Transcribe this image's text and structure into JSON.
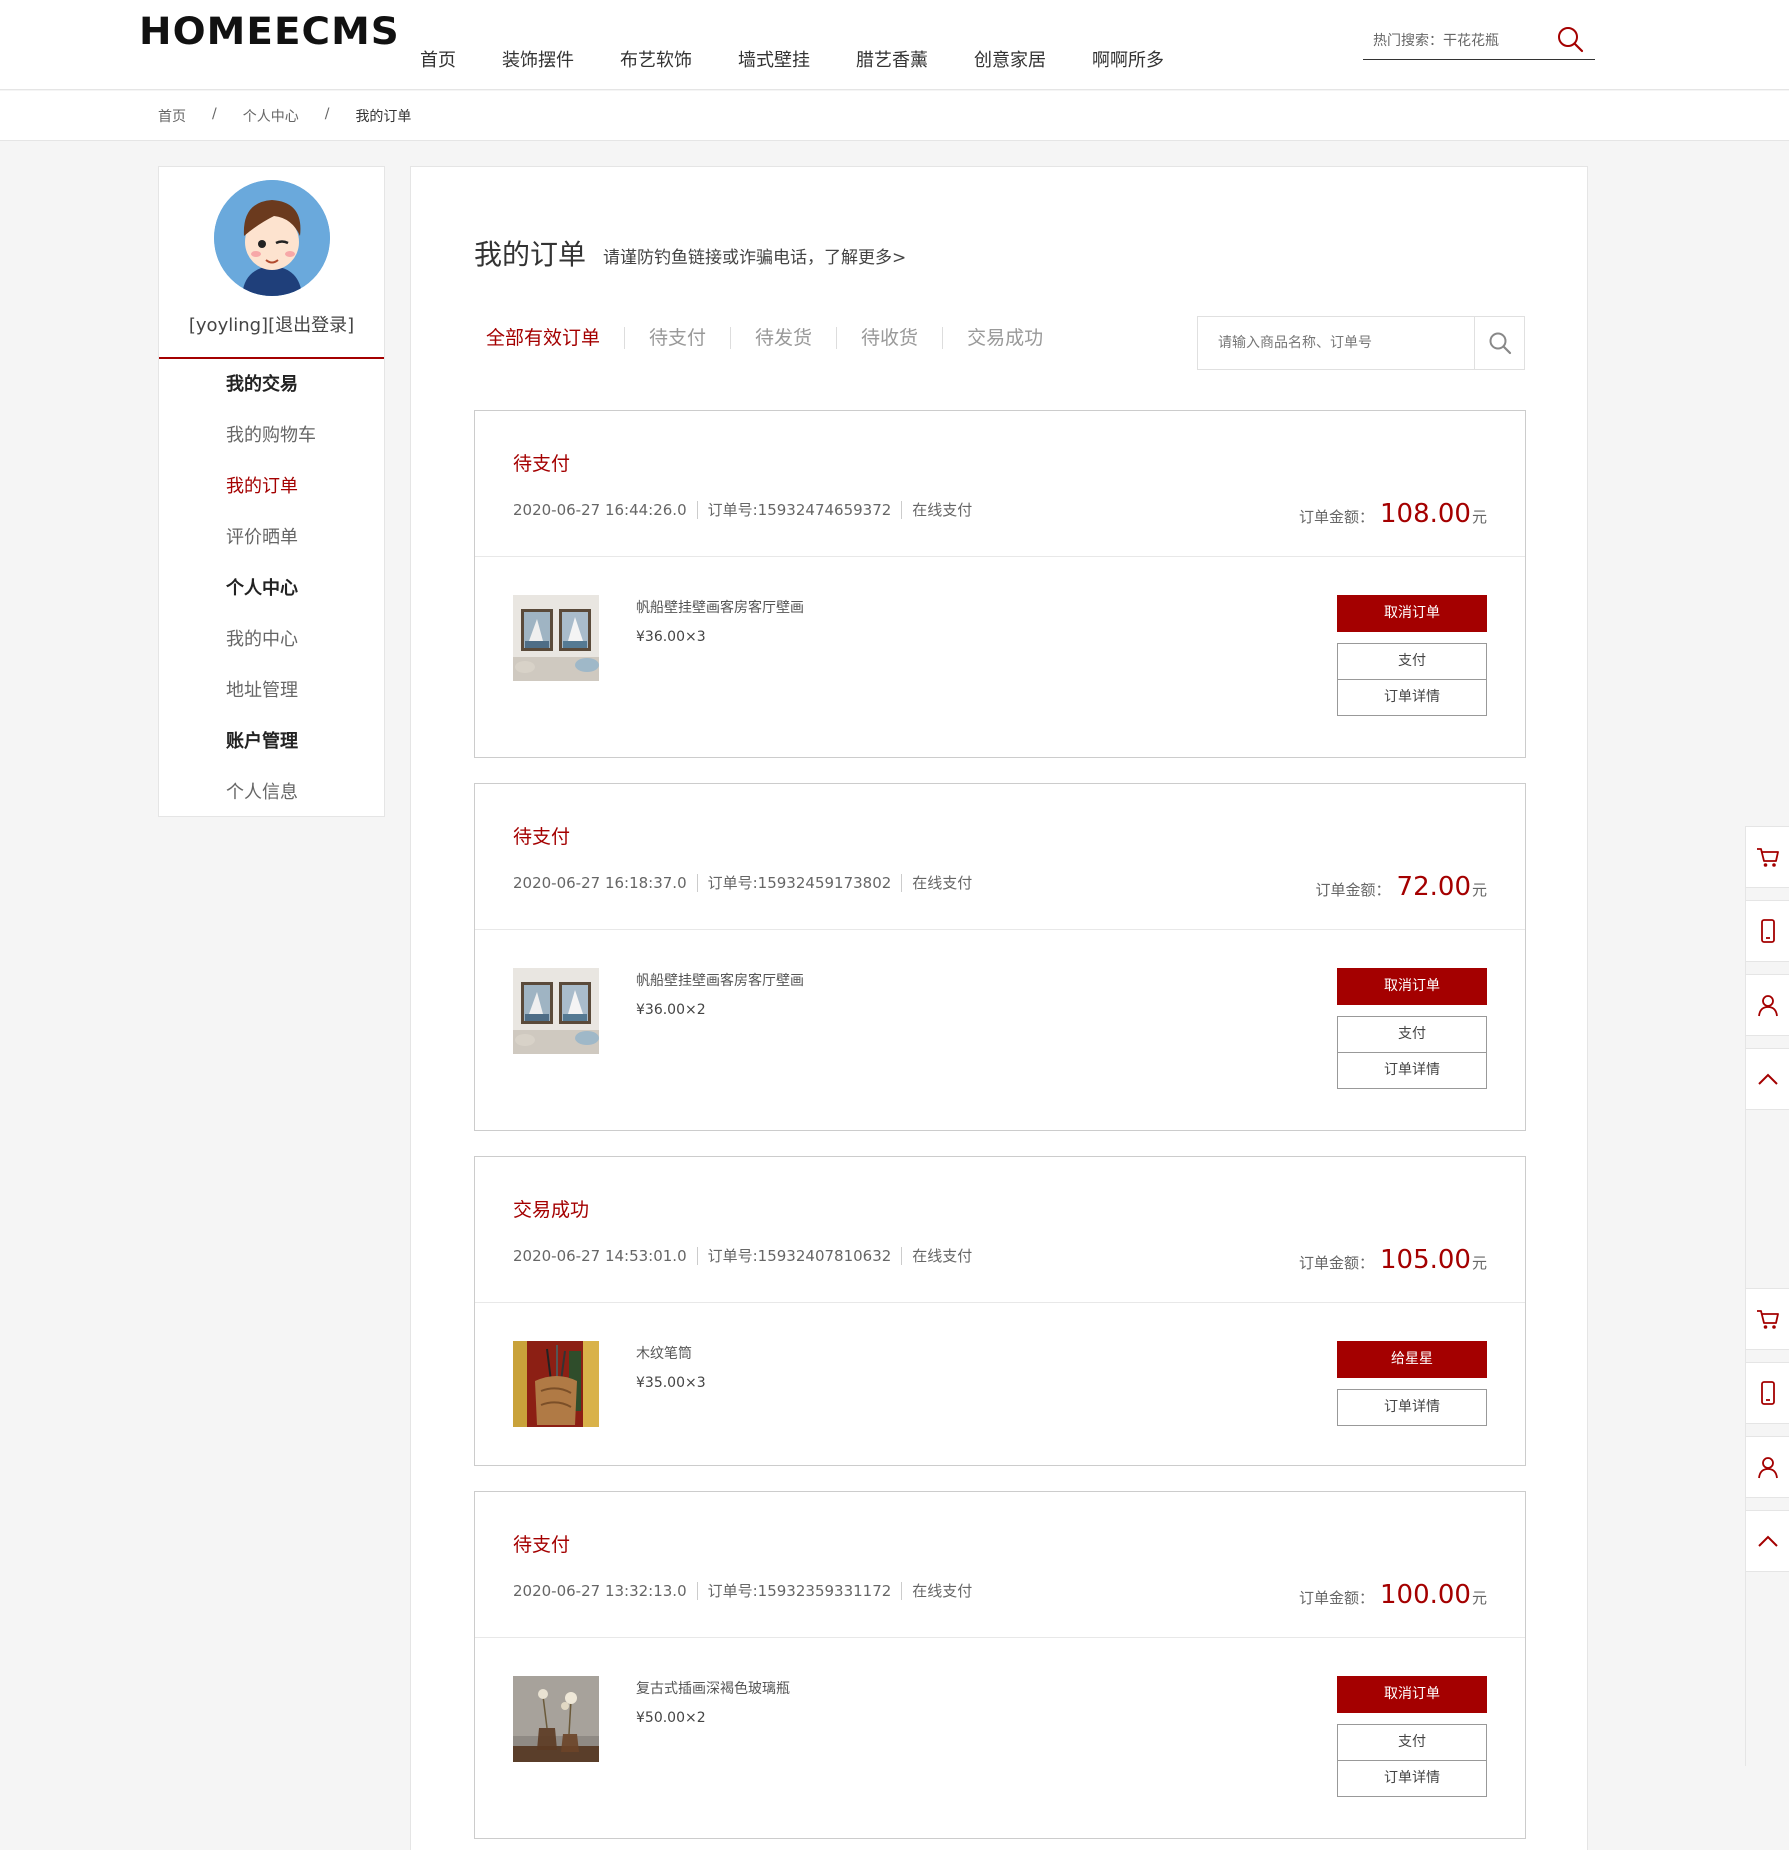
{
  "header": {
    "logo": "HOMEECMS",
    "nav": [
      "首页",
      "装饰摆件",
      "布艺软饰",
      "墙式壁挂",
      "腊艺香薰",
      "创意家居",
      "啊啊所多"
    ],
    "hot_search": "热门搜索：干花花瓶",
    "search_icon": "search-icon"
  },
  "breadcrumb": {
    "items": [
      "首页",
      "个人中心",
      "我的订单"
    ],
    "separator": "/"
  },
  "sidebar": {
    "user_label": "[yoyling]",
    "logout_label": "[退出登录]",
    "menu": [
      {
        "label": "我的交易",
        "type": "group"
      },
      {
        "label": "我的购物车",
        "type": "item"
      },
      {
        "label": "我的订单",
        "type": "active"
      },
      {
        "label": "评价晒单",
        "type": "item"
      },
      {
        "label": "个人中心",
        "type": "group"
      },
      {
        "label": "我的中心",
        "type": "item"
      },
      {
        "label": "地址管理",
        "type": "item"
      },
      {
        "label": "账户管理",
        "type": "group"
      },
      {
        "label": "个人信息",
        "type": "item"
      }
    ]
  },
  "main": {
    "title": "我的订单",
    "subtitle": "请谨防钓鱼链接或诈骗电话，了解更多>",
    "tabs": [
      "全部有效订单",
      "待支付",
      "待发货",
      "待收货",
      "交易成功"
    ],
    "search_placeholder": "请输入商品名称、订单号"
  },
  "labels": {
    "amount_label": "订单金额：",
    "currency_unit": "元"
  },
  "orders": [
    {
      "status": "待支付",
      "datetime": "2020-06-27 16:44:26.0",
      "order_no": "订单号:15932474659372",
      "pay_method": "在线支付",
      "amount": "108.00",
      "product_name": "帆船壁挂壁画客房客厅壁画",
      "product_price": "¥36.00×3",
      "product_image": "sailboat-painting",
      "actions": [
        {
          "label": "取消订单",
          "style": "primary"
        },
        {
          "label": "支付",
          "style": "plain"
        },
        {
          "label": "订单详情",
          "style": "plain"
        }
      ]
    },
    {
      "status": "待支付",
      "datetime": "2020-06-27 16:18:37.0",
      "order_no": "订单号:15932459173802",
      "pay_method": "在线支付",
      "amount": "72.00",
      "product_name": "帆船壁挂壁画客房客厅壁画",
      "product_price": "¥36.00×2",
      "product_image": "sailboat-painting",
      "actions": [
        {
          "label": "取消订单",
          "style": "primary"
        },
        {
          "label": "支付",
          "style": "plain"
        },
        {
          "label": "订单详情",
          "style": "plain"
        }
      ]
    },
    {
      "status": "交易成功",
      "datetime": "2020-06-27 14:53:01.0",
      "order_no": "订单号:15932407810632",
      "pay_method": "在线支付",
      "amount": "105.00",
      "product_name": "木纹笔筒",
      "product_price": "¥35.00×3",
      "product_image": "wood-pen-holder",
      "actions": [
        {
          "label": "给星星",
          "style": "primary"
        },
        {
          "label": "订单详情",
          "style": "plain"
        }
      ]
    },
    {
      "status": "待支付",
      "datetime": "2020-06-27 13:32:13.0",
      "order_no": "订单号:15932359331172",
      "pay_method": "在线支付",
      "amount": "100.00",
      "product_name": "复古式插画深褐色玻璃瓶",
      "product_price": "¥50.00×2",
      "product_image": "glass-vase",
      "actions": [
        {
          "label": "取消订单",
          "style": "primary"
        },
        {
          "label": "支付",
          "style": "plain"
        },
        {
          "label": "订单详情",
          "style": "plain"
        }
      ]
    }
  ],
  "float_toolbar": [
    "cart-icon",
    "mobile-icon",
    "user-icon",
    "back-to-top-icon"
  ],
  "colors": {
    "accent": "#a40000",
    "text": "#333333",
    "page_bg": "#f5f5f5"
  }
}
